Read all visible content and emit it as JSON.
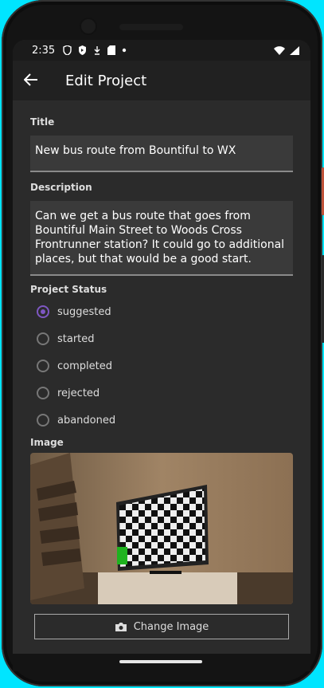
{
  "status_bar": {
    "time": "2:35",
    "icons": [
      "shield-icon",
      "play-shield-icon",
      "download-icon",
      "sd-card-icon",
      "dot-icon"
    ],
    "right_icons": [
      "wifi-icon",
      "signal-icon"
    ]
  },
  "app_bar": {
    "back_icon": "back-arrow-icon",
    "title": "Edit Project"
  },
  "form": {
    "title_label": "Title",
    "title_value": "New bus route from Bountiful to WX",
    "description_label": "Description",
    "description_value": "Can we get a bus route that goes from Bountiful Main Street to Woods Cross Frontrunner station? It could go to additional places, but that would be a good start.",
    "status_label": "Project Status",
    "status_options": [
      {
        "label": "suggested",
        "selected": true
      },
      {
        "label": "started",
        "selected": false
      },
      {
        "label": "completed",
        "selected": false
      },
      {
        "label": "rejected",
        "selected": false
      },
      {
        "label": "abandoned",
        "selected": false
      }
    ],
    "image_label": "Image",
    "change_image_label": "Change Image"
  },
  "colors": {
    "accent": "#7e57c2",
    "background": "#2b2b2b",
    "app_bar": "#212121"
  }
}
